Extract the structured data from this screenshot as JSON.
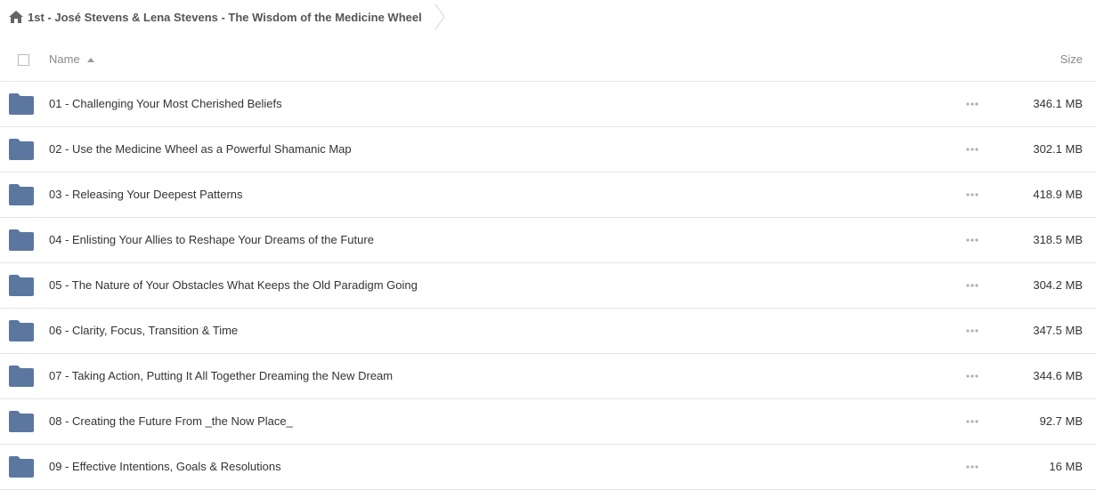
{
  "breadcrumb": {
    "home_icon": "home-icon",
    "label": "1st - José Stevens & Lena Stevens - The Wisdom of the Medicine Wheel"
  },
  "header": {
    "name_label": "Name",
    "size_label": "Size",
    "sort": "ascending"
  },
  "colors": {
    "folder": "#5b77a0",
    "divider": "#e6e6e6",
    "header_text": "#8a8a8a",
    "row_text": "#333333"
  },
  "rows": [
    {
      "name": "01 - Challenging Your Most Cherished Beliefs",
      "size": "346.1 MB",
      "icon": "folder-icon"
    },
    {
      "name": "02 - Use the Medicine Wheel as a Powerful Shamanic Map",
      "size": "302.1 MB",
      "icon": "folder-icon"
    },
    {
      "name": "03 - Releasing Your Deepest Patterns",
      "size": "418.9 MB",
      "icon": "folder-icon"
    },
    {
      "name": "04 - Enlisting Your Allies to Reshape Your Dreams of the Future",
      "size": "318.5 MB",
      "icon": "folder-icon"
    },
    {
      "name": "05 - The Nature of Your Obstacles What Keeps the Old Paradigm Going",
      "size": "304.2 MB",
      "icon": "folder-icon"
    },
    {
      "name": "06 - Clarity, Focus, Transition & Time",
      "size": "347.5 MB",
      "icon": "folder-icon"
    },
    {
      "name": "07 - Taking Action, Putting It All Together Dreaming the New Dream",
      "size": "344.6 MB",
      "icon": "folder-icon"
    },
    {
      "name": "08 - Creating the Future From _the Now Place_",
      "size": "92.7 MB",
      "icon": "folder-icon"
    },
    {
      "name": "09 - Effective Intentions, Goals & Resolutions",
      "size": "16 MB",
      "icon": "folder-icon"
    }
  ]
}
